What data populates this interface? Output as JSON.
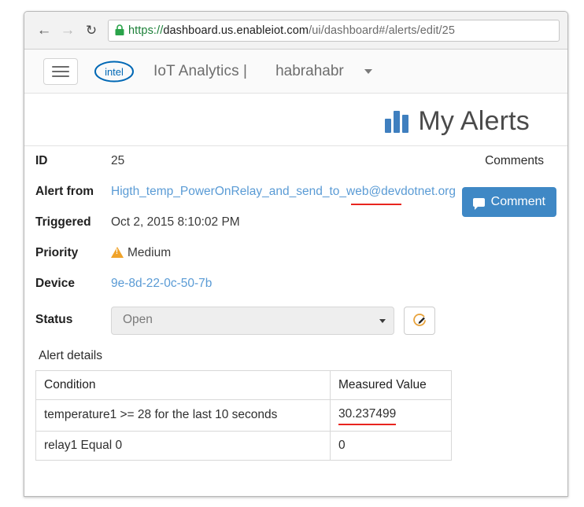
{
  "browser": {
    "back_icon": "back-arrow-icon",
    "forward_icon": "forward-arrow-icon",
    "reload_icon": "reload-icon",
    "lock_icon": "lock-icon",
    "url_full": "https://dashboard.us.enableiot.com/ui/dashboard#/alerts/edit/25",
    "url_scheme": "https://",
    "url_host": "dashboard.us.enableiot.com",
    "url_path": "/ui/dashboard#/alerts/edit/25"
  },
  "appnav": {
    "menu_icon": "hamburger-menu-icon",
    "logo_text": "intel",
    "brand": "IoT Analytics |",
    "account": "habrahabr",
    "caret_icon": "chevron-down-icon"
  },
  "page": {
    "title": "My Alerts",
    "title_icon": "bar-chart-icon"
  },
  "comments": {
    "heading": "Comments",
    "button_label": "Comment",
    "button_icon": "comment-bubble-icon",
    "button_color": "#3f88c5"
  },
  "details": {
    "rows": [
      {
        "term": "ID",
        "value": "25"
      },
      {
        "term": "Alert from",
        "value": "Higth_temp_PowerOnRelay_and_send_to_web@devdotnet.org"
      },
      {
        "term": "Triggered",
        "value": "Oct 2, 2015 8:10:02 PM"
      },
      {
        "term": "Priority",
        "value": "Medium"
      },
      {
        "term": "Device",
        "value": "9e-8d-22-0c-50-7b"
      },
      {
        "term": "Status",
        "value": "Open"
      }
    ],
    "priority_icon": "warning-triangle-icon",
    "priority_color": "#f0a32a",
    "link_color": "#5a9bd5",
    "highlight_color": "#e8251f",
    "status_selected": "Open",
    "status_caret_icon": "select-caret-icon",
    "edit_icon": "edit-pencil-icon"
  },
  "alert_details": {
    "section_label": "Alert details",
    "columns": [
      "Condition",
      "Measured Value"
    ],
    "rows": [
      {
        "condition": "temperature1 >= 28 for the last 10 seconds",
        "measured": "30.237499",
        "highlighted": true
      },
      {
        "condition": "relay1 Equal 0",
        "measured": "0",
        "highlighted": false
      }
    ]
  }
}
